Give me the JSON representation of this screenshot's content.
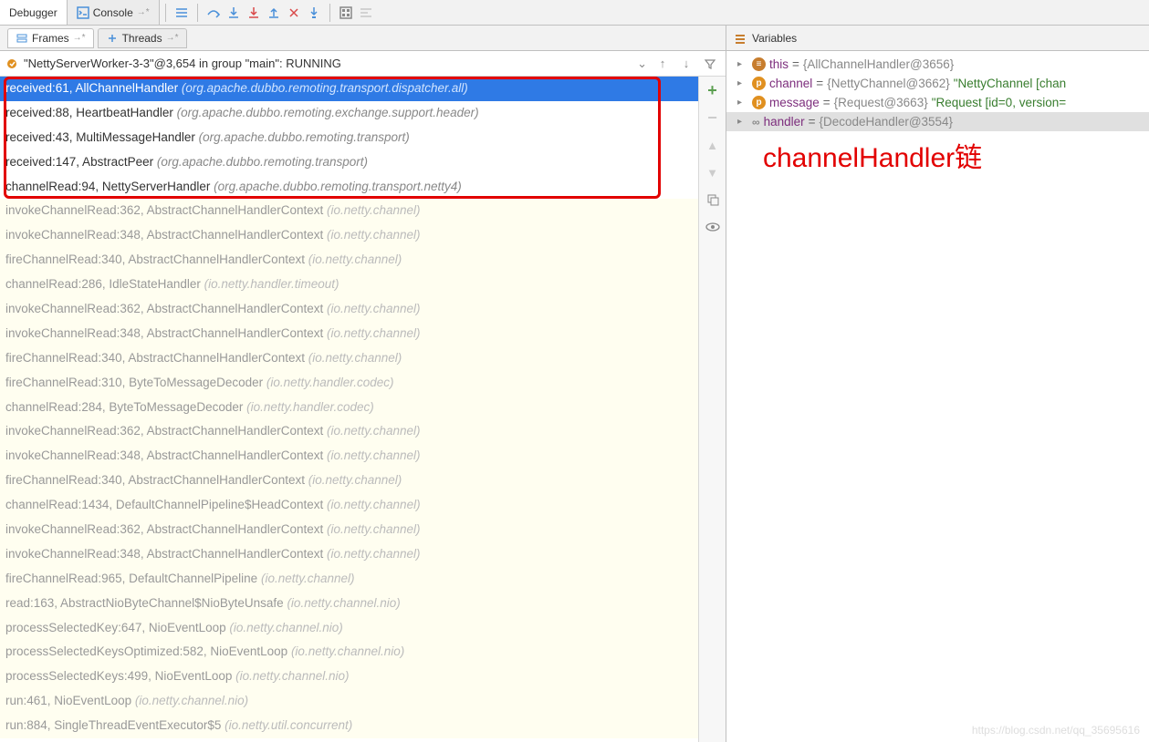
{
  "topTabs": {
    "debugger": "Debugger",
    "console": "Console"
  },
  "panelTabs": {
    "frames": "Frames",
    "threads": "Threads"
  },
  "variablesHeader": "Variables",
  "thread": {
    "text": "\"NettyServerWorker-3-3\"@3,654 in group \"main\": RUNNING"
  },
  "frames": [
    {
      "hi": true,
      "sel": true,
      "main": "received:61, AllChannelHandler ",
      "pkg": "(org.apache.dubbo.remoting.transport.dispatcher.all)"
    },
    {
      "hi": true,
      "main": "received:88, HeartbeatHandler ",
      "pkg": "(org.apache.dubbo.remoting.exchange.support.header)"
    },
    {
      "hi": true,
      "main": "received:43, MultiMessageHandler ",
      "pkg": "(org.apache.dubbo.remoting.transport)"
    },
    {
      "hi": true,
      "main": "received:147, AbstractPeer ",
      "pkg": "(org.apache.dubbo.remoting.transport)"
    },
    {
      "hi": true,
      "main": "channelRead:94, NettyServerHandler ",
      "pkg": "(org.apache.dubbo.remoting.transport.netty4)"
    },
    {
      "main": "invokeChannelRead:362, AbstractChannelHandlerContext ",
      "pkg": "(io.netty.channel)"
    },
    {
      "main": "invokeChannelRead:348, AbstractChannelHandlerContext ",
      "pkg": "(io.netty.channel)"
    },
    {
      "main": "fireChannelRead:340, AbstractChannelHandlerContext ",
      "pkg": "(io.netty.channel)"
    },
    {
      "main": "channelRead:286, IdleStateHandler ",
      "pkg": "(io.netty.handler.timeout)"
    },
    {
      "main": "invokeChannelRead:362, AbstractChannelHandlerContext ",
      "pkg": "(io.netty.channel)"
    },
    {
      "main": "invokeChannelRead:348, AbstractChannelHandlerContext ",
      "pkg": "(io.netty.channel)"
    },
    {
      "main": "fireChannelRead:340, AbstractChannelHandlerContext ",
      "pkg": "(io.netty.channel)"
    },
    {
      "main": "fireChannelRead:310, ByteToMessageDecoder ",
      "pkg": "(io.netty.handler.codec)"
    },
    {
      "main": "channelRead:284, ByteToMessageDecoder ",
      "pkg": "(io.netty.handler.codec)"
    },
    {
      "main": "invokeChannelRead:362, AbstractChannelHandlerContext ",
      "pkg": "(io.netty.channel)"
    },
    {
      "main": "invokeChannelRead:348, AbstractChannelHandlerContext ",
      "pkg": "(io.netty.channel)"
    },
    {
      "main": "fireChannelRead:340, AbstractChannelHandlerContext ",
      "pkg": "(io.netty.channel)"
    },
    {
      "main": "channelRead:1434, DefaultChannelPipeline$HeadContext ",
      "pkg": "(io.netty.channel)"
    },
    {
      "main": "invokeChannelRead:362, AbstractChannelHandlerContext ",
      "pkg": "(io.netty.channel)"
    },
    {
      "main": "invokeChannelRead:348, AbstractChannelHandlerContext ",
      "pkg": "(io.netty.channel)"
    },
    {
      "main": "fireChannelRead:965, DefaultChannelPipeline ",
      "pkg": "(io.netty.channel)"
    },
    {
      "main": "read:163, AbstractNioByteChannel$NioByteUnsafe ",
      "pkg": "(io.netty.channel.nio)"
    },
    {
      "main": "processSelectedKey:647, NioEventLoop ",
      "pkg": "(io.netty.channel.nio)"
    },
    {
      "main": "processSelectedKeysOptimized:582, NioEventLoop ",
      "pkg": "(io.netty.channel.nio)"
    },
    {
      "main": "processSelectedKeys:499, NioEventLoop ",
      "pkg": "(io.netty.channel.nio)"
    },
    {
      "main": "run:461, NioEventLoop ",
      "pkg": "(io.netty.channel.nio)"
    },
    {
      "main": "run:884, SingleThreadEventExecutor$5 ",
      "pkg": "(io.netty.util.concurrent)"
    }
  ],
  "vars": [
    {
      "icon": "this",
      "name": "this",
      "val": "{AllChannelHandler@3656}",
      "sel": false
    },
    {
      "icon": "p",
      "name": "channel",
      "val": "{NettyChannel@3662}",
      "tail": " \"NettyChannel [chan",
      "sel": false
    },
    {
      "icon": "p",
      "name": "message",
      "val": "{Request@3663}",
      "tail": " \"Request [id=0, version=",
      "sel": false
    },
    {
      "icon": "oo",
      "name": "handler",
      "val": "{DecodeHandler@3554}",
      "sel": true
    }
  ],
  "annotation": "channelHandler链",
  "watermark": "https://blog.csdn.net/qq_35695616"
}
